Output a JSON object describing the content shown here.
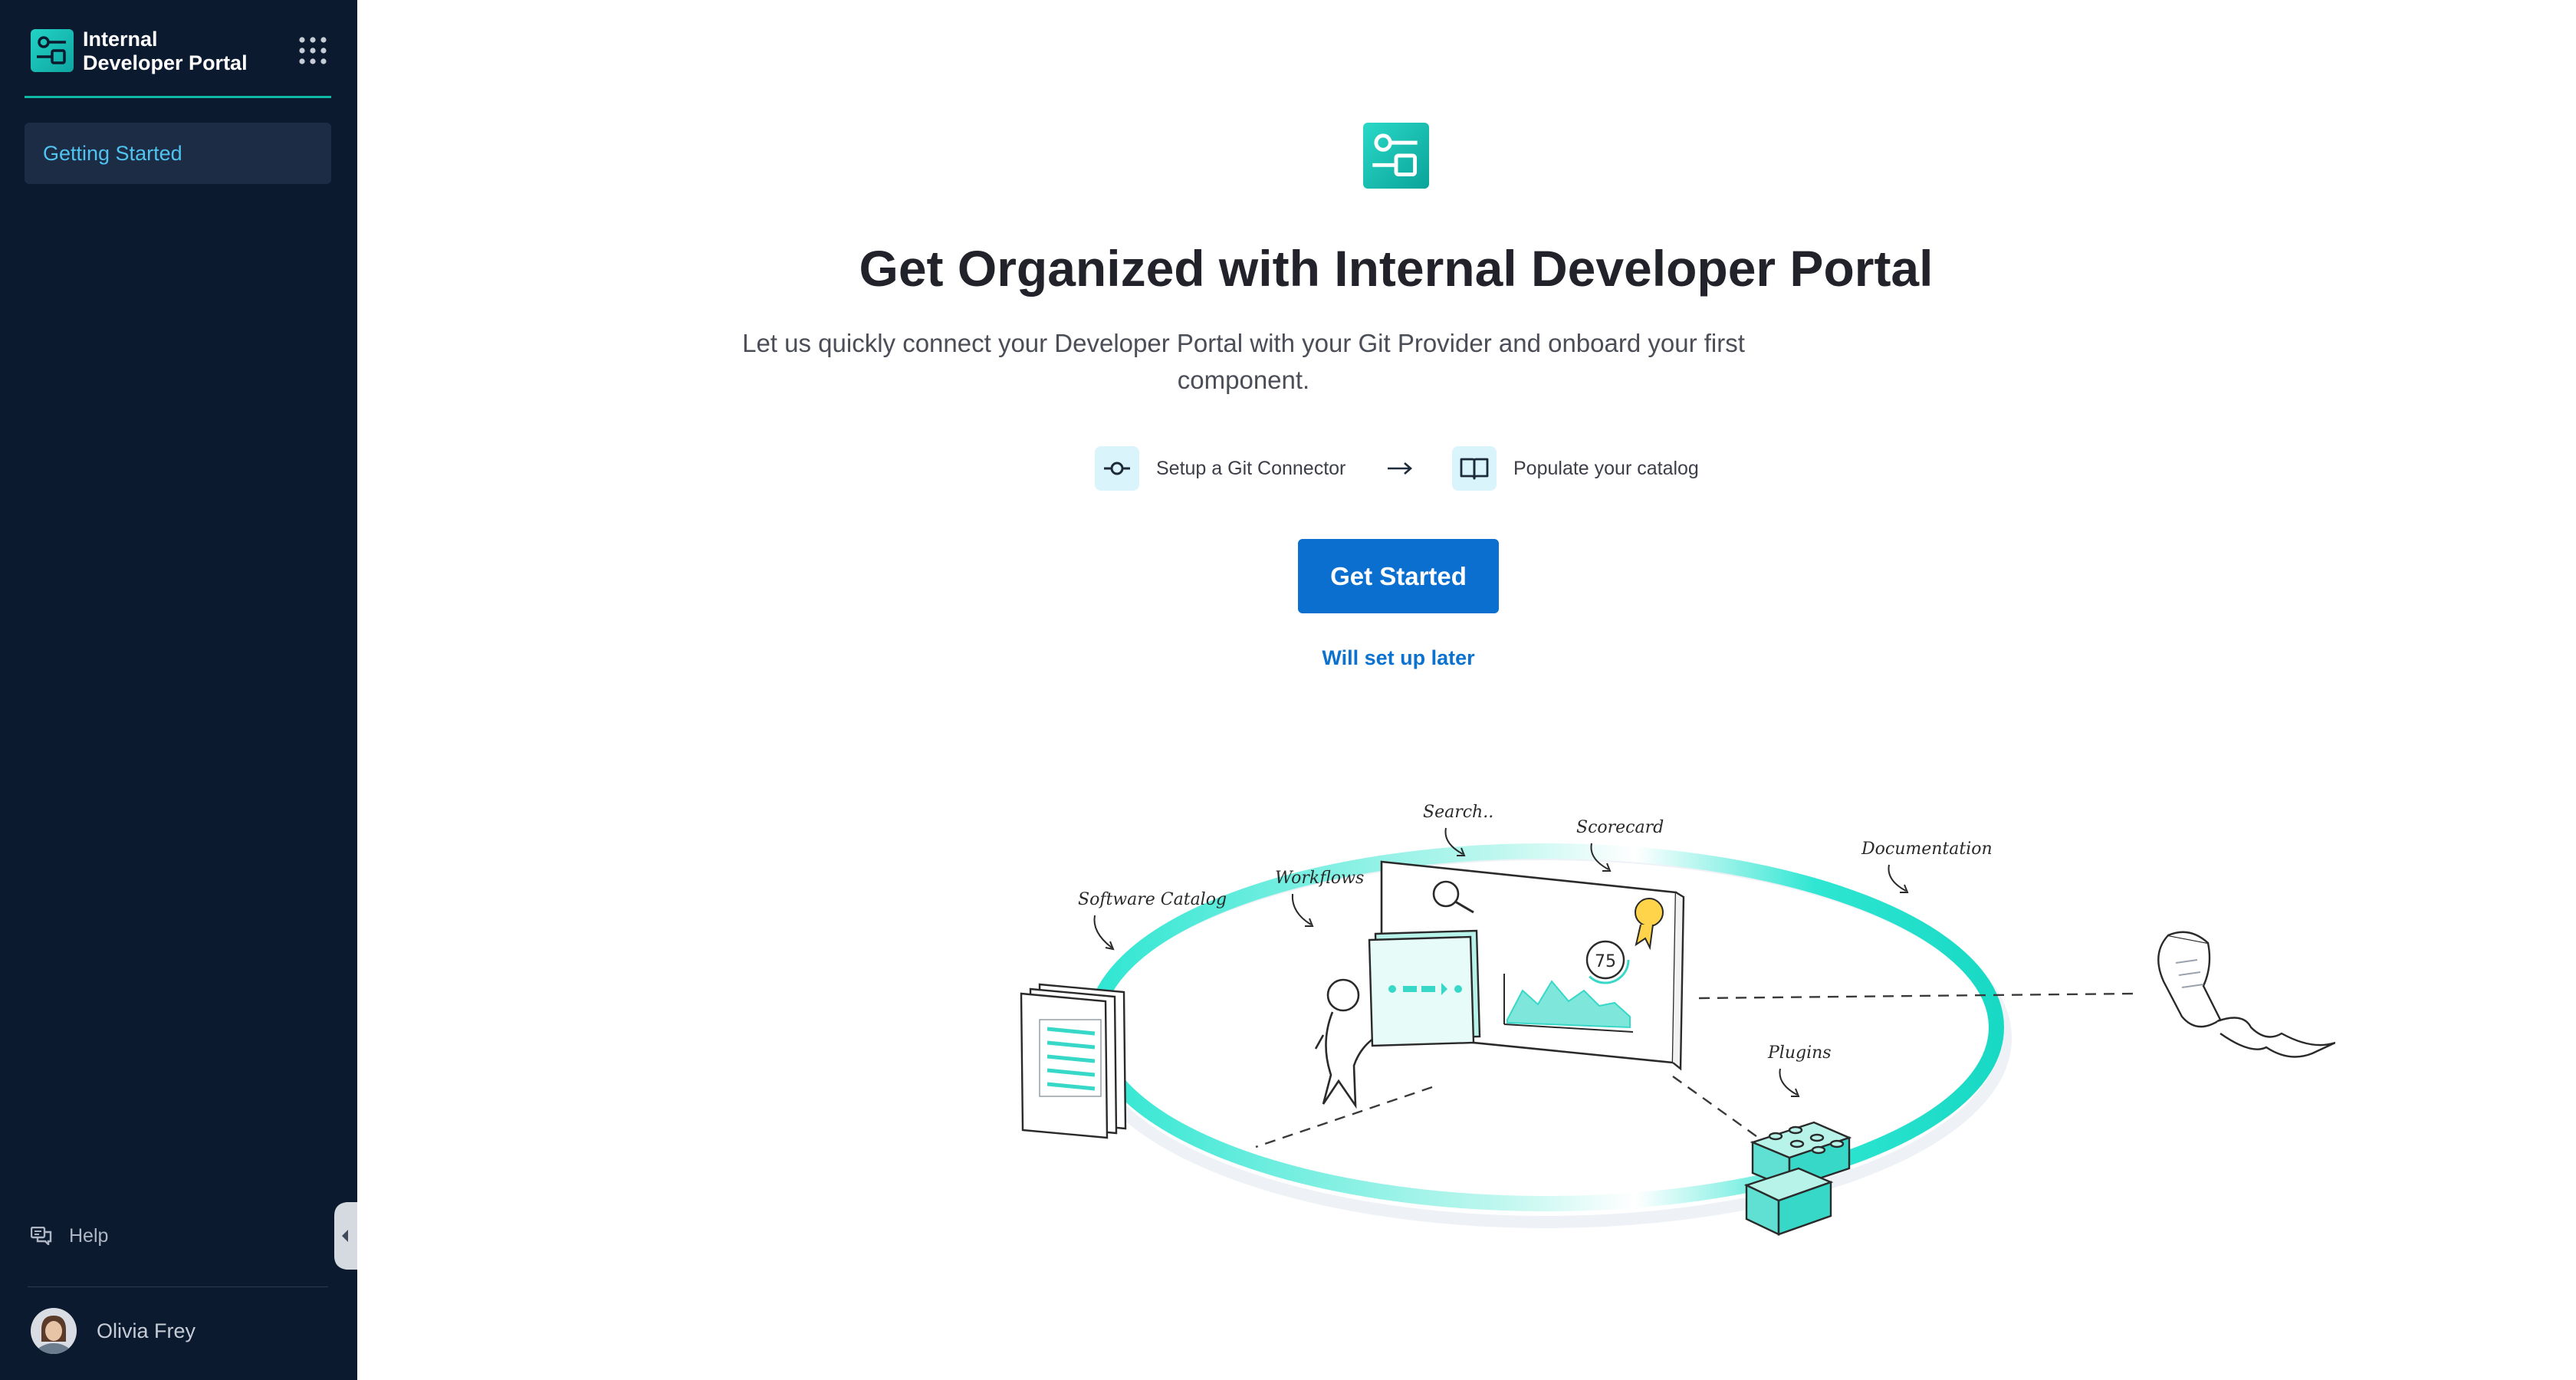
{
  "sidebar": {
    "brand": {
      "line1": "Internal",
      "line2": "Developer Portal"
    },
    "apps_icon": "grid-dots-icon",
    "nav_items": [
      {
        "label": "Getting Started",
        "active": true
      }
    ],
    "help_label": "Help",
    "user_name": "Olivia Frey"
  },
  "main": {
    "title": "Get Organized with Internal Developer Portal",
    "subtitle": "Let us quickly connect your Developer Portal with your Git Provider and onboard your first component.",
    "steps": [
      {
        "label": "Setup a Git Connector",
        "icon": "git-commit-icon"
      },
      {
        "label": "Populate your catalog",
        "icon": "open-book-icon"
      }
    ],
    "primary_button": "Get Started",
    "secondary_link": "Will set up later",
    "illustration_labels": {
      "search": "Search..",
      "scorecard": "Scorecard",
      "workflows": "Workflows",
      "software_catalog": "Software Catalog",
      "documentation": "Documentation",
      "plugins": "Plugins",
      "score_value": "75"
    }
  },
  "colors": {
    "sidebar_bg": "#0b1a2f",
    "accent_teal": "#10b8a6",
    "primary_blue": "#0b6fcf",
    "nav_active_text": "#4fc4f0"
  }
}
